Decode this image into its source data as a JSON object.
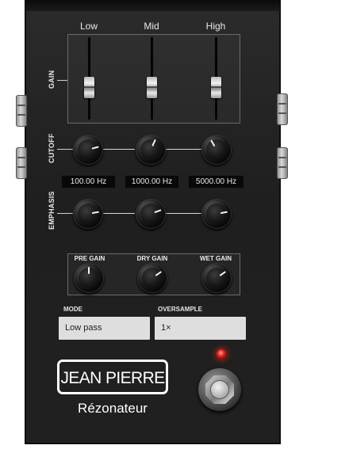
{
  "gain": {
    "section_label": "GAIN",
    "bands": [
      {
        "label": "Low",
        "level": 0.55
      },
      {
        "label": "Mid",
        "level": 0.55
      },
      {
        "label": "High",
        "level": 0.55
      }
    ]
  },
  "cutoff": {
    "section_label": "CUTOFF",
    "knobs": [
      {
        "name": "cutoff-low",
        "value": "100.00 Hz",
        "angle": 75
      },
      {
        "name": "cutoff-mid",
        "value": "1000.00 Hz",
        "angle": 25
      },
      {
        "name": "cutoff-high",
        "value": "5000.00 Hz",
        "angle": -30
      }
    ]
  },
  "emphasis": {
    "section_label": "EMPHASIS",
    "knobs": [
      {
        "name": "emphasis-low",
        "angle": 80
      },
      {
        "name": "emphasis-mid",
        "angle": 70
      },
      {
        "name": "emphasis-high",
        "angle": 80
      }
    ]
  },
  "gain_stage": {
    "pre_gain_label": "PRE GAIN",
    "dry_gain_label": "DRY GAIN",
    "wet_gain_label": "WET GAIN"
  },
  "mode": {
    "label": "MODE",
    "value": "Low pass"
  },
  "oversample": {
    "label": "OVERSAMPLE",
    "value": "1×"
  },
  "brand": {
    "name": "JEAN PIERRE",
    "product": "Rézonateur"
  },
  "colors": {
    "led": "#ff2a1a",
    "panel": "#222222",
    "select_bg": "#dedede"
  }
}
